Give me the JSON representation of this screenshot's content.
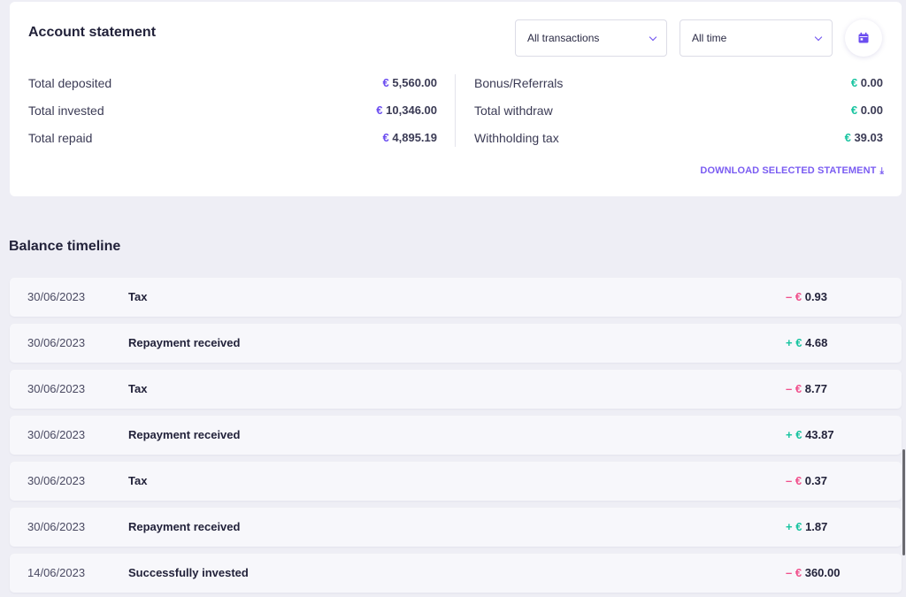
{
  "statement": {
    "title": "Account statement",
    "filter_transactions": "All transactions",
    "filter_time": "All time",
    "calendar_icon": "calendar-icon",
    "left": [
      {
        "label": "Total deposited",
        "currency": "€",
        "value": "5,560.00"
      },
      {
        "label": "Total invested",
        "currency": "€",
        "value": "10,346.00"
      },
      {
        "label": "Total repaid",
        "currency": "€",
        "value": "4,895.19"
      }
    ],
    "right": [
      {
        "label": "Bonus/Referrals",
        "currency": "€",
        "value": "0.00"
      },
      {
        "label": "Total withdraw",
        "currency": "€",
        "value": "0.00"
      },
      {
        "label": "Withholding tax",
        "currency": "€",
        "value": "39.03"
      }
    ],
    "download_label": "DOWNLOAD SELECTED STATEMENT",
    "download_icon": "download-icon"
  },
  "timeline": {
    "title": "Balance timeline",
    "rows": [
      {
        "date": "30/06/2023",
        "description": "Tax",
        "sign": "–",
        "currency": "€",
        "amount": "0.93",
        "type": "negative"
      },
      {
        "date": "30/06/2023",
        "description": "Repayment received",
        "sign": "+",
        "currency": "€",
        "amount": "4.68",
        "type": "positive"
      },
      {
        "date": "30/06/2023",
        "description": "Tax",
        "sign": "–",
        "currency": "€",
        "amount": "8.77",
        "type": "negative"
      },
      {
        "date": "30/06/2023",
        "description": "Repayment received",
        "sign": "+",
        "currency": "€",
        "amount": "43.87",
        "type": "positive"
      },
      {
        "date": "30/06/2023",
        "description": "Tax",
        "sign": "–",
        "currency": "€",
        "amount": "0.37",
        "type": "negative"
      },
      {
        "date": "30/06/2023",
        "description": "Repayment received",
        "sign": "+",
        "currency": "€",
        "amount": "1.87",
        "type": "positive"
      },
      {
        "date": "14/06/2023",
        "description": "Successfully invested",
        "sign": "–",
        "currency": "€",
        "amount": "360.00",
        "type": "negative"
      }
    ]
  },
  "colors": {
    "accent": "#6b4df0",
    "positive": "#18c4a0",
    "negative": "#f0508c",
    "background": "#eeeef5"
  }
}
